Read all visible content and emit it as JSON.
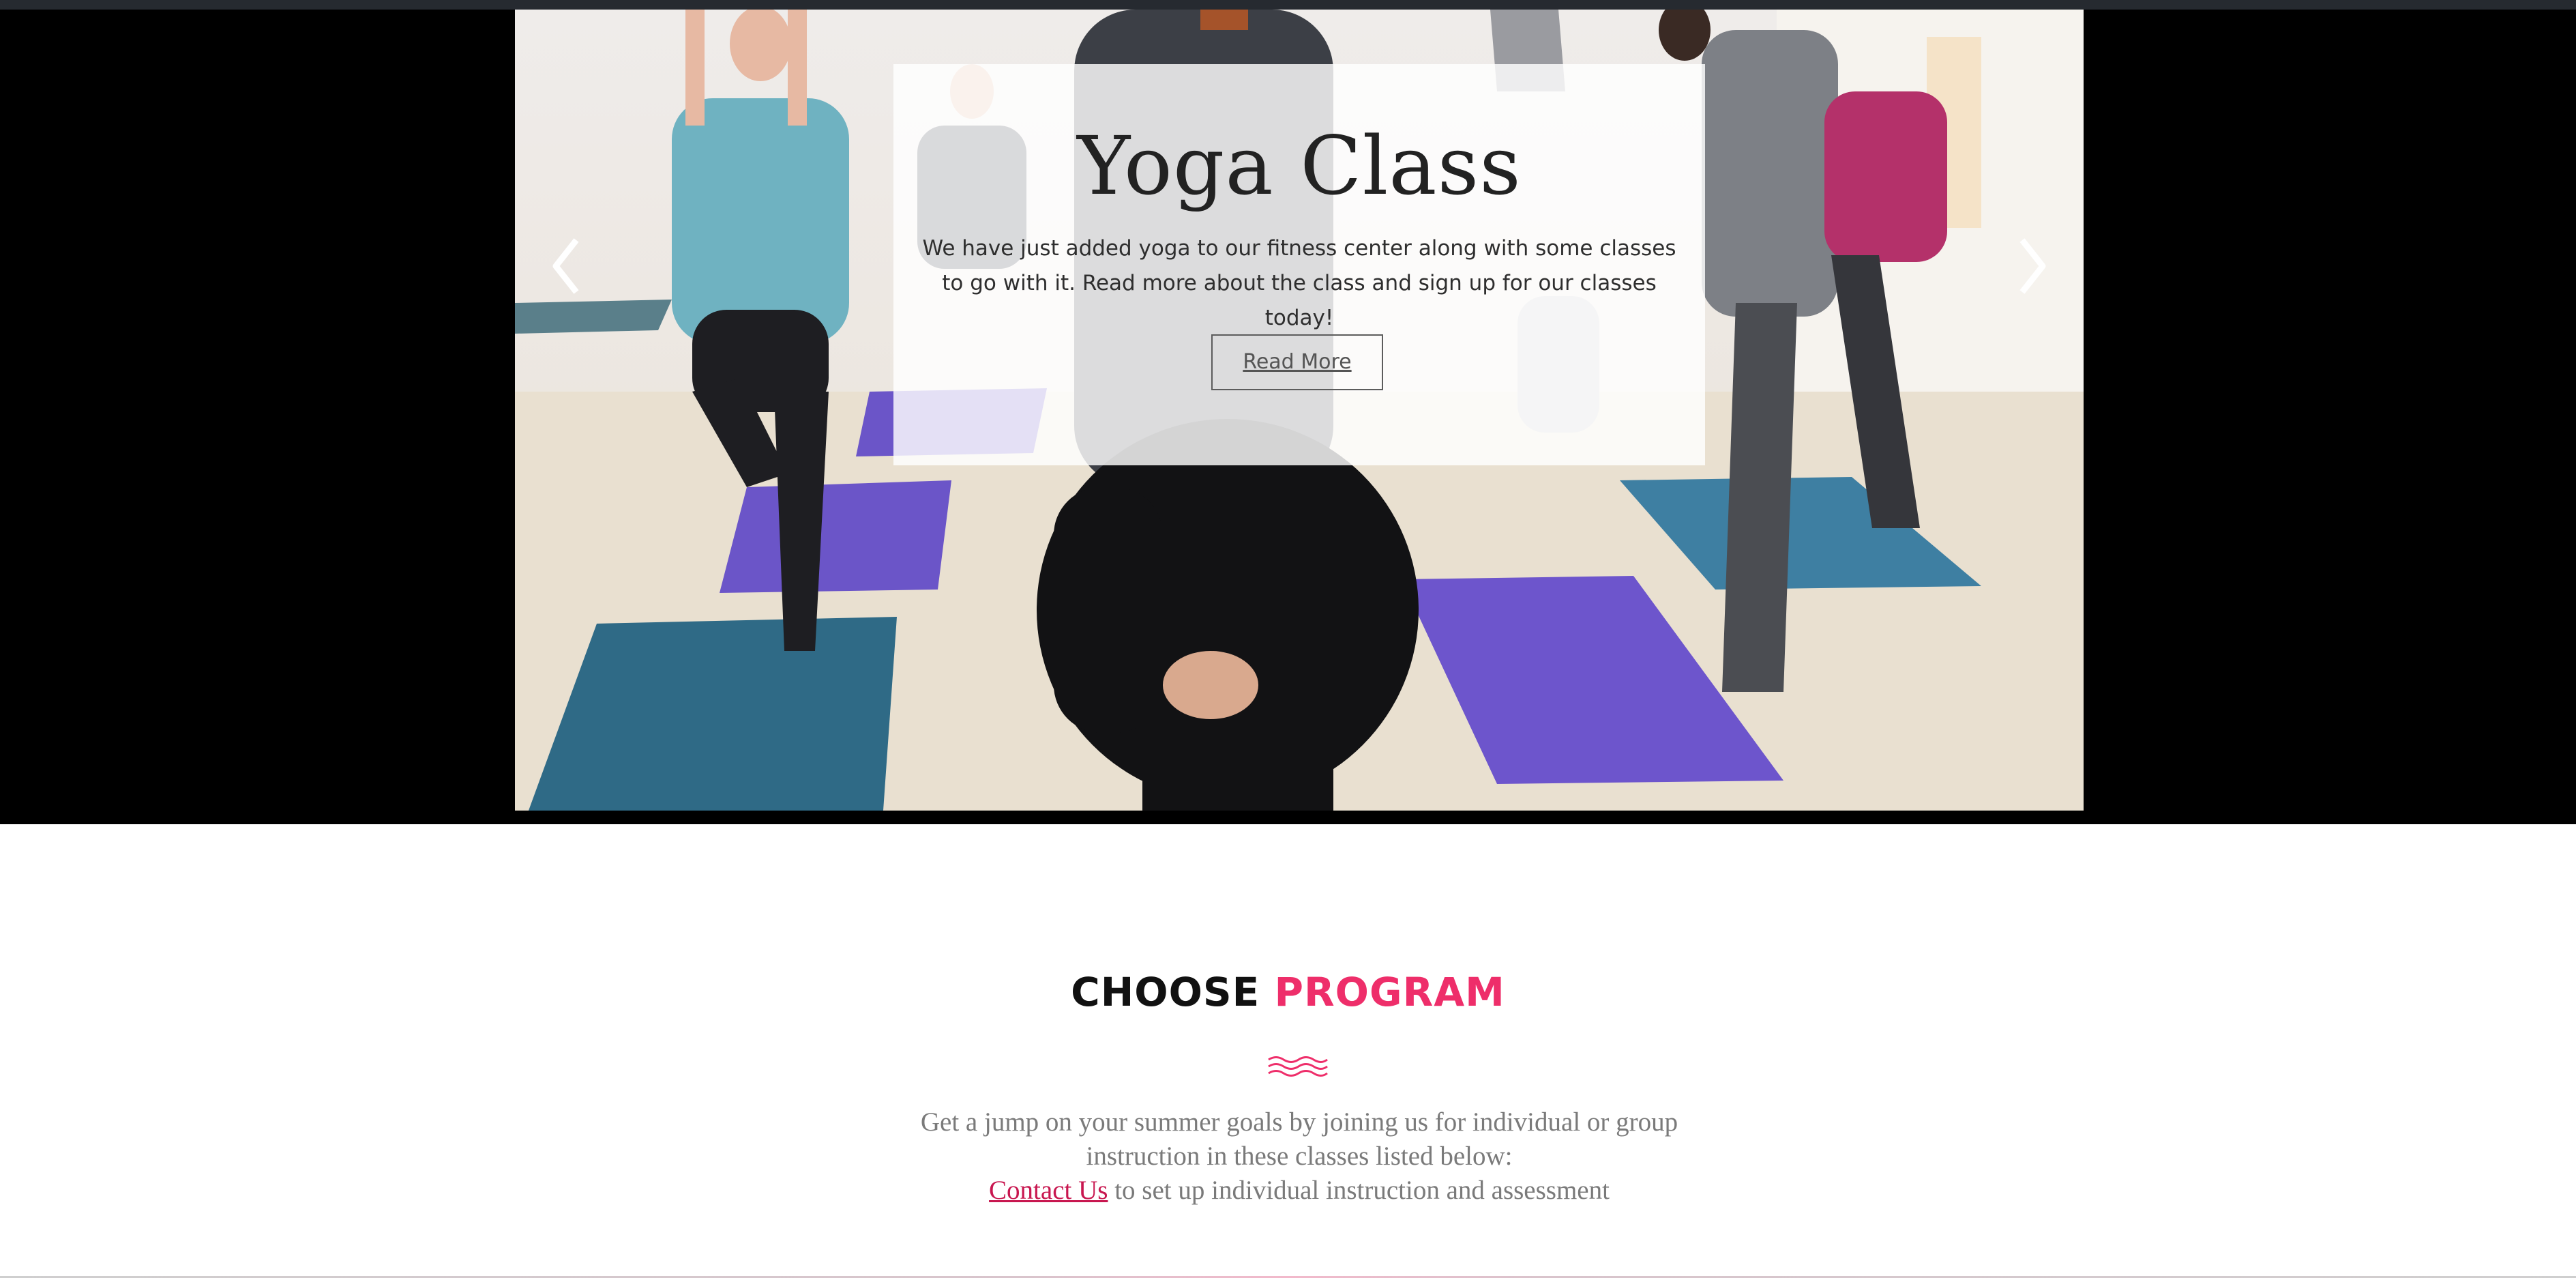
{
  "hero": {
    "title": "Yoga Class",
    "description": "We have just added yoga to our fitness center along with some classes to go with it. Read more about the class and sign up for our classes today!",
    "button_label": "Read More",
    "prev_icon": "chevron-left-icon",
    "next_icon": "chevron-right-icon"
  },
  "program": {
    "title_part1": "CHOOSE",
    "title_part2": "PROGRAM",
    "accent_color": "#ee2e6a",
    "divider_icon": "wave-icon",
    "intro_line": "Get a jump on your summer goals by joining us for individual or group instruction in these classes listed below:",
    "contact_link": "Contact Us",
    "contact_suffix": "to set up individual instruction and assessment"
  }
}
